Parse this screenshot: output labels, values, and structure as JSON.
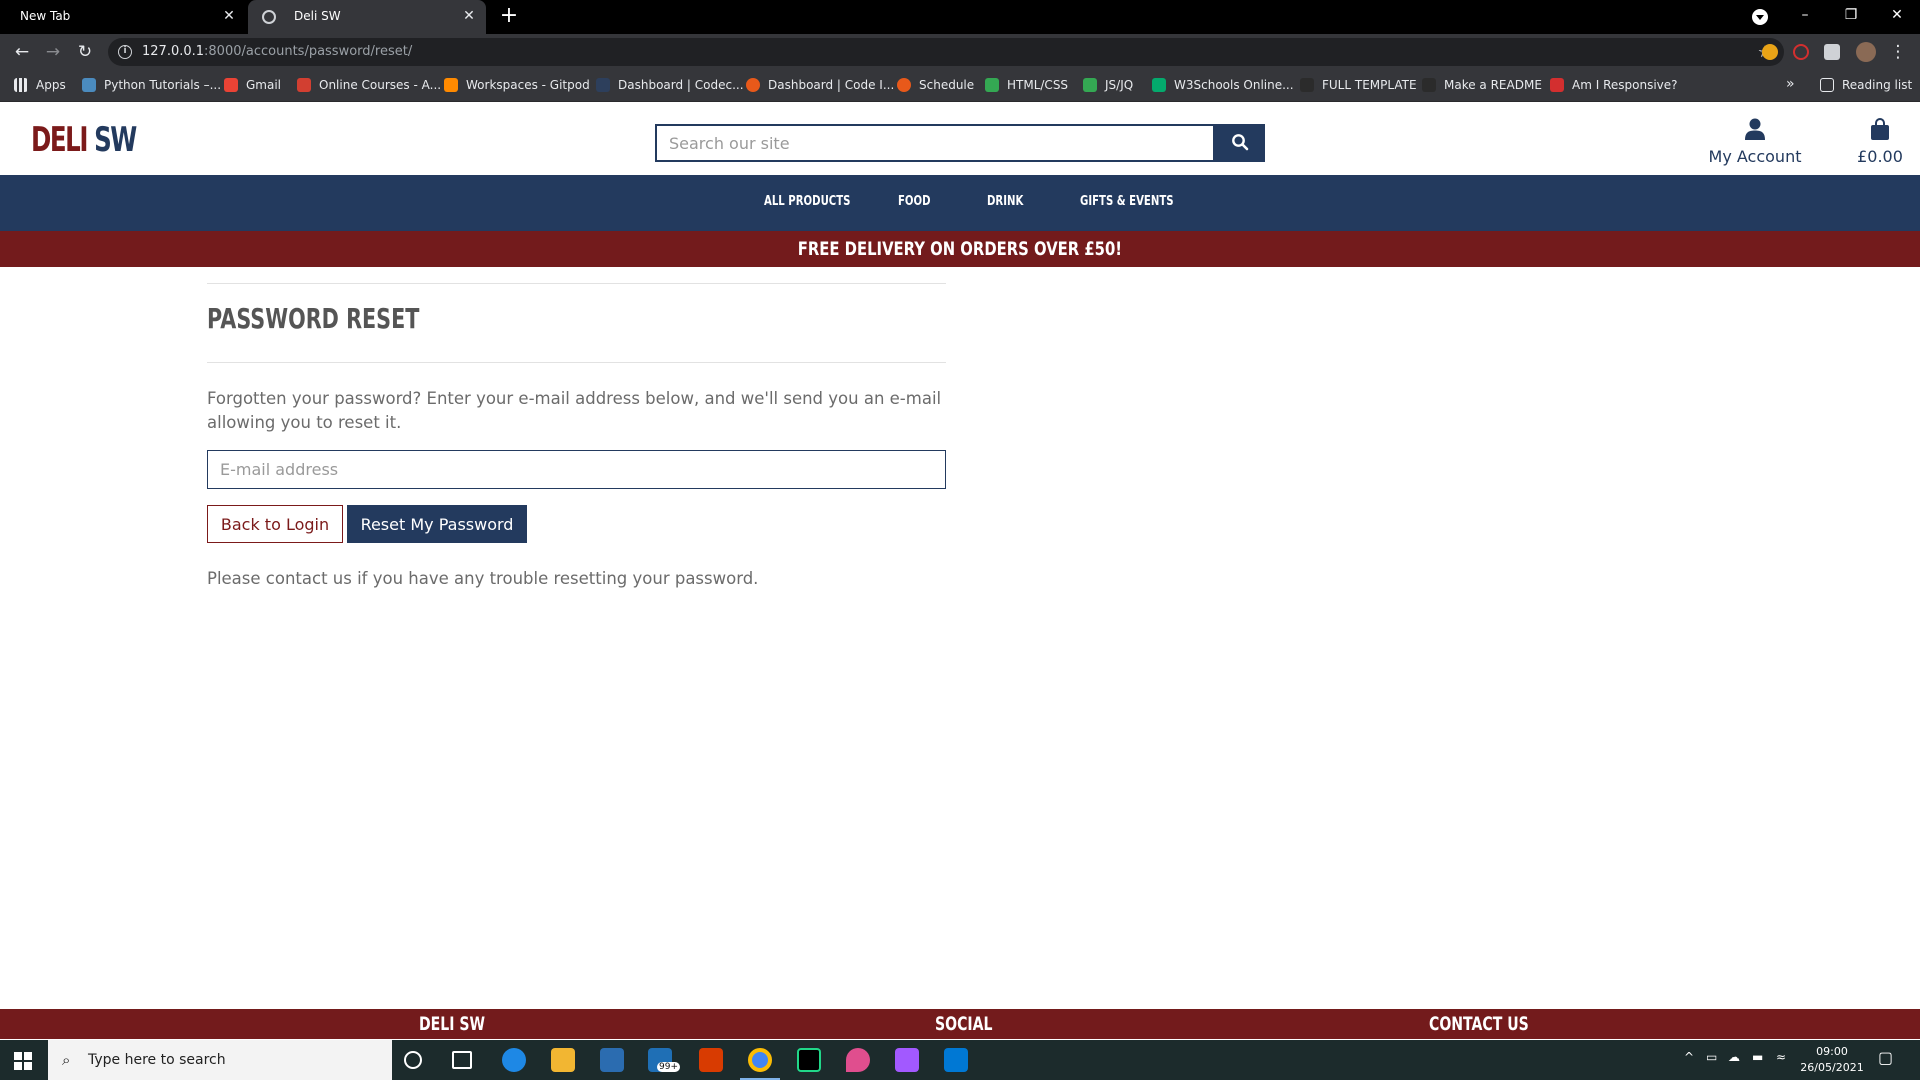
{
  "browser": {
    "tabs": [
      {
        "title": "New Tab",
        "active": false
      },
      {
        "title": "Deli SW",
        "active": true
      }
    ],
    "url_host": "127.0.0.1",
    "url_rest": ":8000/accounts/password/reset/",
    "bookmarks": [
      "Apps",
      "Python Tutorials –...",
      "Gmail",
      "Online Courses - A...",
      "Workspaces - Gitpod",
      "Dashboard | Codec...",
      "Dashboard | Code I...",
      "Schedule",
      "HTML/CSS",
      "JS/JQ",
      "W3Schools Online...",
      "FULL TEMPLATE",
      "Make a README",
      "Am I Responsive?"
    ],
    "reading_list": "Reading list"
  },
  "site": {
    "logo_part1": "DELI",
    "logo_part2": "SW",
    "search_placeholder": "Search our site",
    "account_label": "My Account",
    "bag_total": "£0.00",
    "nav": [
      "ALL PRODUCTS",
      "FOOD",
      "DRINK",
      "GIFTS & EVENTS"
    ],
    "banner": "FREE DELIVERY ON ORDERS OVER £50!",
    "colors": {
      "navy": "#233a5e",
      "maroon": "#731b1c"
    }
  },
  "page": {
    "title": "PASSWORD RESET",
    "intro": "Forgotten your password? Enter your e-mail address below, and we'll send you an e-mail allowing you to reset it.",
    "email_placeholder": "E-mail address",
    "back_button": "Back to Login",
    "reset_button": "Reset My Password",
    "help": "Please contact us if you have any trouble resetting your password."
  },
  "footer": {
    "col1": "DELI SW",
    "col2": "SOCIAL",
    "col3": "CONTACT US"
  },
  "taskbar": {
    "search_placeholder": "Type here to search",
    "mail_badge": "99+",
    "time": "09:00",
    "date": "26/05/2021"
  }
}
